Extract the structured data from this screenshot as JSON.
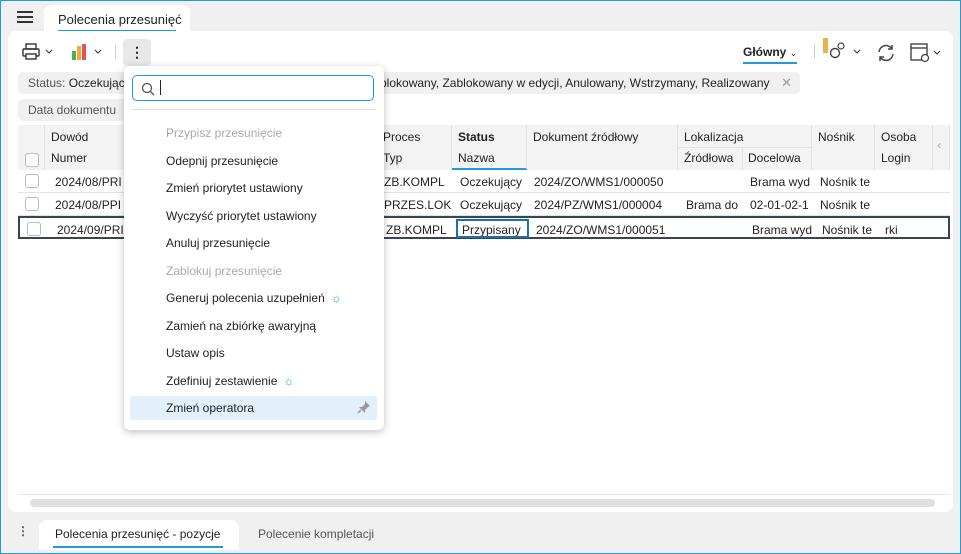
{
  "window": {
    "tab_title": "Polecenia przesunięć"
  },
  "toolbar": {
    "print_icon": "printer-icon",
    "chart_icon": "bar-chart-icon",
    "more_icon": "kebab-icon",
    "view_label": "Główny",
    "settings_icon": "gear-warning-icon",
    "refresh_icon": "refresh-icon",
    "layout_icon": "window-settings-icon"
  },
  "filters": {
    "status_label": "Status:",
    "status_value_start": "Oczekując",
    "status_value_end": "blokowany, Zablokowany w edycji, Anulowany, Wstrzymany, Realizowany",
    "date_label": "Data dokumentu"
  },
  "table": {
    "headers": {
      "dowod": "Dowód",
      "numer": "Numer",
      "proces": "Proces",
      "typ": "Typ",
      "status": "Status",
      "nazwa": "Nazwa",
      "dokument": "Dokument źródłowy",
      "lokalizacja": "Lokalizacja",
      "zrodlowa": "Źródłowa",
      "docelowa": "Docelowa",
      "nosnik": "Nośnik",
      "osoba": "Osoba",
      "login": "Login"
    },
    "rows": [
      {
        "numer": "2024/08/PRI",
        "typ": "ZB.KOMPL",
        "status": "Oczekujący",
        "dokument": "2024/ZO/WMS1/000050",
        "zrodlowa": "",
        "docelowa": "Brama wyd",
        "nosnik": "Nośnik te",
        "login": ""
      },
      {
        "numer": "2024/08/PPI",
        "typ": "PRZES.LOK",
        "status": "Oczekujący",
        "dokument": "2024/PZ/WMS1/000004",
        "zrodlowa": "Brama do",
        "docelowa": "02-01-02-1",
        "nosnik": "Nośnik te",
        "login": ""
      },
      {
        "numer": "2024/09/PRI",
        "typ": "ZB.KOMPL",
        "status": "Przypisany",
        "dokument": "2024/ZO/WMS1/000051",
        "zrodlowa": "",
        "docelowa": "Brama wyd",
        "nosnik": "Nośnik te",
        "login": "rki"
      }
    ]
  },
  "menu": {
    "search_value": "",
    "items": [
      {
        "label": "Przypisz przesunięcie",
        "disabled": true
      },
      {
        "label": "Odepnij przesunięcie"
      },
      {
        "label": "Zmień priorytet ustawiony"
      },
      {
        "label": "Wyczyść priorytet ustawiony"
      },
      {
        "label": "Anuluj przesunięcie"
      },
      {
        "label": "Zablokuj przesunięcie",
        "disabled": true
      },
      {
        "label": "Generuj polecenia uzupełnień",
        "icon": "lightbulb-icon"
      },
      {
        "label": "Zamień na zbiórkę awaryjną"
      },
      {
        "label": "Ustaw opis"
      },
      {
        "label": "Zdefiniuj zestawienie",
        "icon": "lightbulb-icon"
      },
      {
        "label": "Zmień operatora",
        "highlighted": true,
        "icon2": "pin-icon"
      }
    ]
  },
  "bottom_tabs": [
    {
      "label": "Polecenia przesunięć - pozycje",
      "active": true
    },
    {
      "label": "Polecenie kompletacji"
    }
  ],
  "colors": {
    "accent": "#1e9be0",
    "selected_row_border": "#37474f"
  }
}
